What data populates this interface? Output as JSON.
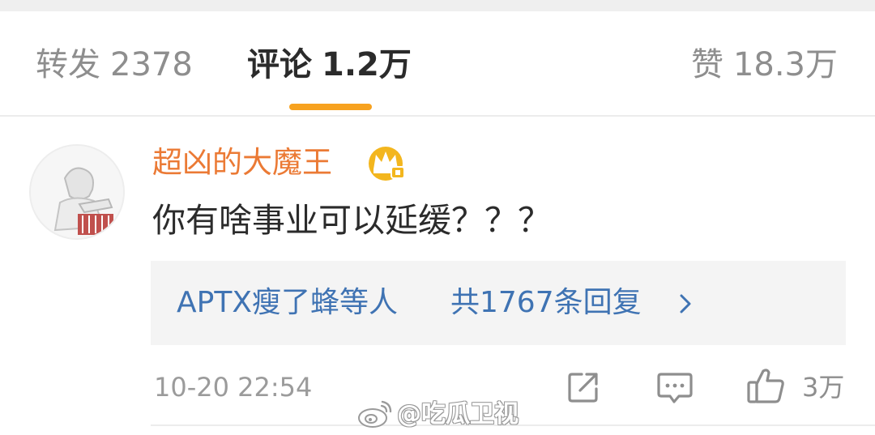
{
  "tabs": {
    "repost": {
      "label": "转发",
      "count": "2378"
    },
    "comments": {
      "label": "评论",
      "count": "1.2万"
    },
    "likes": {
      "label": "赞",
      "count": "18.3万"
    }
  },
  "comment": {
    "username": "超凶的大魔王",
    "badge_icon": "crown-vip-icon",
    "text": "你有啥事业可以延缓？？？",
    "replies": {
      "who": "APTX瘦了蜂等人",
      "count": "共1767条回复",
      "arrow_icon": "chevron-right-icon"
    },
    "timestamp": "10-20 22:54",
    "likes": "3万"
  },
  "watermark": {
    "text": "@吃瓜卫视",
    "logo_icon": "weibo-logo-icon"
  },
  "colors": {
    "accent_tab": "#f7a21f",
    "username": "#eb7a35",
    "reply_link": "#3f73b3",
    "secondary_text": "#9b9b9b"
  }
}
